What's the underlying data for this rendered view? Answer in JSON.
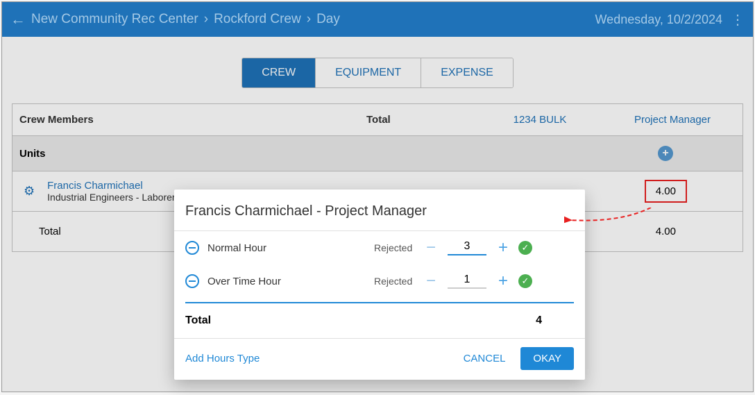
{
  "header": {
    "breadcrumb": {
      "project": "New Community Rec Center",
      "crew": "Rockford Crew",
      "day": "Day"
    },
    "date_label": "Wednesday, 10/2/2024"
  },
  "tabs": {
    "crew": "CREW",
    "equipment": "EQUIPMENT",
    "expense": "EXPENSE"
  },
  "table": {
    "columns": {
      "members": "Crew Members",
      "total": "Total",
      "bulk": "1234 BULK",
      "pm": "Project Manager"
    },
    "units_label": "Units",
    "member": {
      "name": "Francis Charmichael",
      "role": "Industrial Engineers - Laborer",
      "hours": "4.00"
    },
    "total_label": "Total",
    "total_value": "4.00"
  },
  "modal": {
    "title": "Francis Charmichael - Project Manager",
    "rows": [
      {
        "label": "Normal Hour",
        "status": "Rejected",
        "value": "3"
      },
      {
        "label": "Over Time Hour",
        "status": "Rejected",
        "value": "1"
      }
    ],
    "total_label": "Total",
    "total_value": "4",
    "add_hours": "Add Hours Type",
    "cancel": "CANCEL",
    "okay": "OKAY"
  }
}
